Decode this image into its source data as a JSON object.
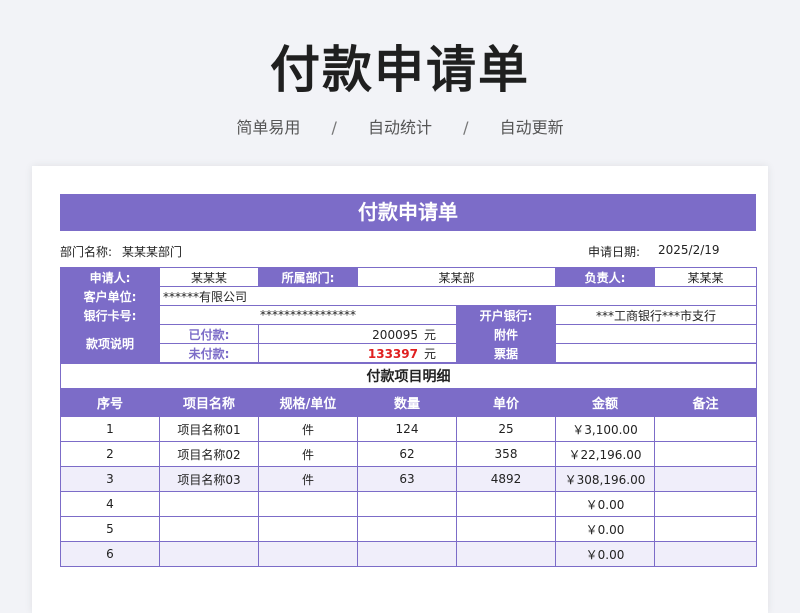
{
  "hero": {
    "title": "付款申请单",
    "tags": [
      "简单易用",
      "自动统计",
      "自动更新"
    ],
    "separator": "/"
  },
  "form": {
    "title": "付款申请单",
    "dept_label": "部门名称:",
    "dept_value": "某某某部门",
    "date_label": "申请日期:",
    "date_value": "2025/2/19",
    "applicant_label": "申请人:",
    "applicant_value": "某某某",
    "dept2_label": "所属部门:",
    "dept2_value": "某某部",
    "owner_label": "负责人:",
    "owner_value": "某某某",
    "client_label": "客户单位:",
    "client_value": "******有限公司",
    "card_label": "银行卡号:",
    "card_value": "****************",
    "bank_label": "开户银行:",
    "bank_value": "***工商银行***市支行",
    "payment_label": "款项说明",
    "paid_label": "已付款:",
    "paid_value": "200095",
    "unpaid_label": "未付款:",
    "unpaid_value": "133397",
    "unit": "元",
    "attach_label": "附件",
    "receipt_label": "票据"
  },
  "detail": {
    "title": "付款项目明细",
    "headers": [
      "序号",
      "项目名称",
      "规格/单位",
      "数量",
      "单价",
      "金额",
      "备注"
    ],
    "rows": [
      [
        "1",
        "项目名称01",
        "件",
        "124",
        "25",
        "￥3,100.00",
        ""
      ],
      [
        "2",
        "项目名称02",
        "件",
        "62",
        "358",
        "￥22,196.00",
        ""
      ],
      [
        "3",
        "项目名称03",
        "件",
        "63",
        "4892",
        "￥308,196.00",
        ""
      ],
      [
        "4",
        "",
        "",
        "",
        "",
        "￥0.00",
        ""
      ],
      [
        "5",
        "",
        "",
        "",
        "",
        "￥0.00",
        ""
      ],
      [
        "6",
        "",
        "",
        "",
        "",
        "￥0.00",
        ""
      ]
    ]
  },
  "colors": {
    "accent": "#7c6cc8",
    "alt_row": "#f0eefa",
    "alert": "#e02020"
  }
}
